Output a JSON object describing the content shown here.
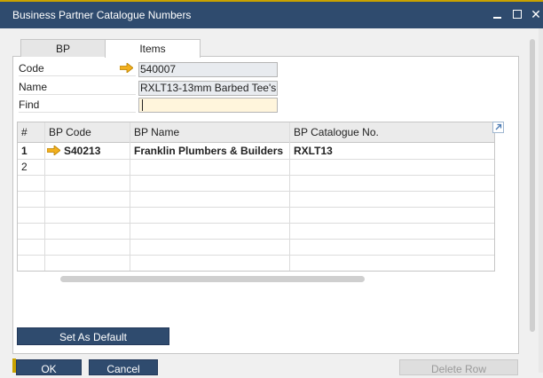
{
  "window": {
    "title": "Business Partner Catalogue Numbers"
  },
  "tabs": [
    {
      "label": "BP",
      "active": false
    },
    {
      "label": "Items",
      "active": true
    }
  ],
  "form": {
    "code_label": "Code",
    "code_value": "540007",
    "name_label": "Name",
    "name_value": "RXLT13-13mm Barbed Tee's",
    "find_label": "Find",
    "find_value": ""
  },
  "grid": {
    "headers": [
      "#",
      "BP Code",
      "BP Name",
      "BP Catalogue No."
    ],
    "rows": [
      {
        "num": "1",
        "bp_code": "S40213",
        "bp_name": "Franklin Plumbers & Builders",
        "catalogue_no": "RXLT13"
      },
      {
        "num": "2",
        "bp_code": "",
        "bp_name": "",
        "catalogue_no": ""
      }
    ]
  },
  "buttons": {
    "set_default": "Set As Default",
    "ok": "OK",
    "cancel": "Cancel",
    "delete": "Delete Row"
  },
  "colors": {
    "titlebar": "#2f4b6e",
    "button": "#2f4b6e",
    "link_arrow": "#f2b01e",
    "find_field": "#fff5dc"
  }
}
